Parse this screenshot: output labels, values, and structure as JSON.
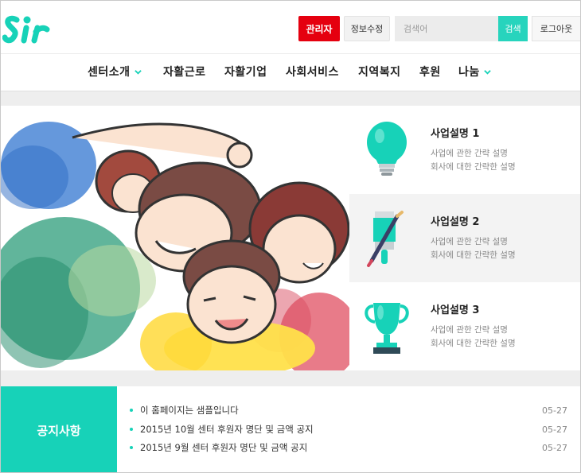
{
  "header": {
    "admin_label": "관리자",
    "edit_label": "정보수정",
    "search_placeholder": "검색어",
    "search_button": "검색",
    "logout_label": "로그아웃"
  },
  "nav": {
    "items": [
      {
        "label": "센터소개",
        "has_dropdown": true
      },
      {
        "label": "자활근로",
        "has_dropdown": false
      },
      {
        "label": "자활기업",
        "has_dropdown": false
      },
      {
        "label": "사회서비스",
        "has_dropdown": false
      },
      {
        "label": "지역복지",
        "has_dropdown": false
      },
      {
        "label": "후원",
        "has_dropdown": false
      },
      {
        "label": "나눔",
        "has_dropdown": true
      }
    ]
  },
  "business": [
    {
      "title": "사업설명 1",
      "desc1": "사업에 관한 간략 설명",
      "desc2": "회사에 대한 간략한 설명",
      "icon": "lightbulb-icon"
    },
    {
      "title": "사업설명 2",
      "desc1": "사업에 관한 간략 설명",
      "desc2": "회사에 대한 간략한 설명",
      "icon": "paint-brush-icon"
    },
    {
      "title": "사업설명 3",
      "desc1": "사업에 관한 간략 설명",
      "desc2": "회사에 대한 간략한 설명",
      "icon": "trophy-icon"
    }
  ],
  "notice": {
    "title": "공지사항",
    "items": [
      {
        "text": "이 홈페이지는 샘플입니다",
        "date": "05-27"
      },
      {
        "text": "2015년 10월 센터 후원자 명단 및 금액 공지",
        "date": "05-27"
      },
      {
        "text": "2015년 9월 센터 후원자 명단 및 금액 공지",
        "date": "05-27"
      }
    ]
  },
  "colors": {
    "accent": "#17d2b8",
    "admin": "#e5000f"
  }
}
